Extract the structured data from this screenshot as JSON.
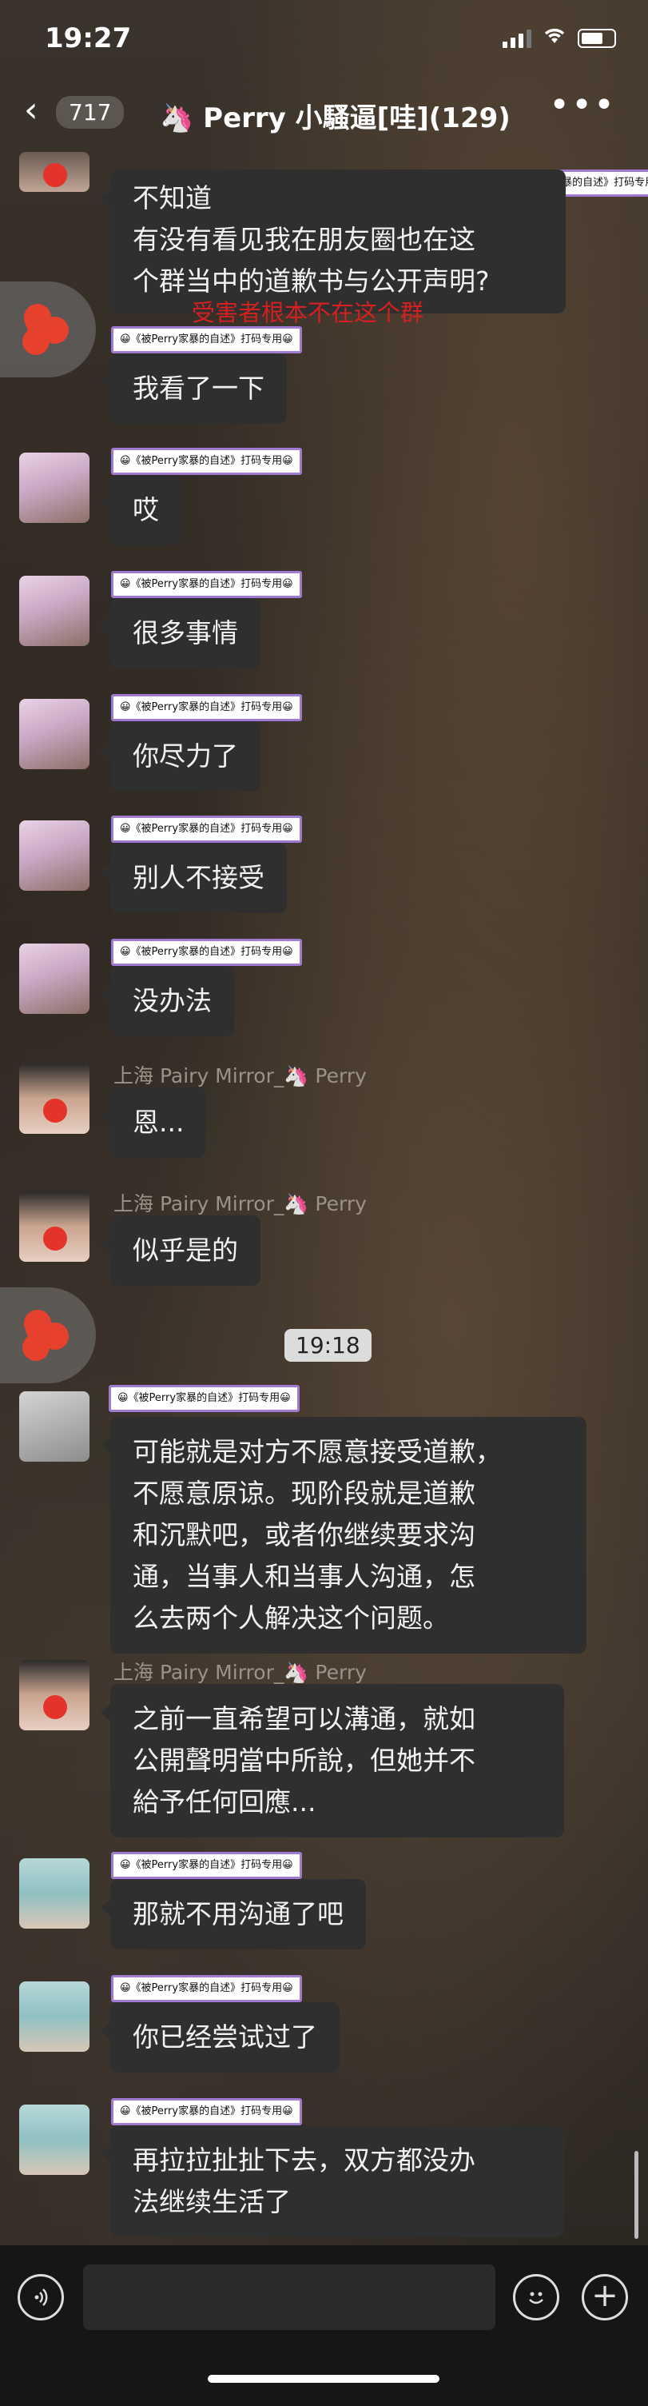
{
  "status": {
    "time": "19:27"
  },
  "nav": {
    "back_count": "717",
    "title": "🦄 Perry 小騷逼[哇](129)",
    "more": "•••"
  },
  "tag_text": "😀《被Perry家暴的自述》打码专用😀",
  "messages": [
    {
      "text": "不知道\n有没有看见我在朋友圈也在这\n个群当中的道歉书与公开声明?"
    },
    {
      "text": "我看了一下"
    },
    {
      "text": "哎"
    },
    {
      "text": "很多事情"
    },
    {
      "text": "你尽力了"
    },
    {
      "text": "别人不接受"
    },
    {
      "text": "没办法"
    },
    {
      "sender": "上海 Pairy Mirror_🦄 Perry",
      "text": "恩..."
    },
    {
      "sender": "上海 Pairy Mirror_🦄 Perry",
      "text": "似乎是的"
    },
    {
      "text": "可能就是对方不愿意接受道歉，\n不愿意原谅。现阶段就是道歉\n和沉默吧，或者你继续要求沟\n通，当事人和当事人沟通，怎\n么去两个人解决这个问题。"
    },
    {
      "sender": "上海 Pairy Mirror_🦄 Perry",
      "text": "之前一直希望可以溝通，就如\n公開聲明當中所說，但她并不\n給予任何回應..."
    },
    {
      "text": "那就不用沟通了吧"
    },
    {
      "text": "你已经尝试过了"
    },
    {
      "text": "再拉拉扯扯下去，双方都没办\n法继续生活了"
    }
  ],
  "red_note": "受害者根本不在这个群",
  "time_divider": "19:18",
  "input": {
    "placeholder": ""
  },
  "icons": {
    "back": "chevron-left-icon",
    "more": "more-dots-icon",
    "voice": "voice-icon",
    "emoji": "emoji-icon",
    "plus": "plus-icon"
  }
}
